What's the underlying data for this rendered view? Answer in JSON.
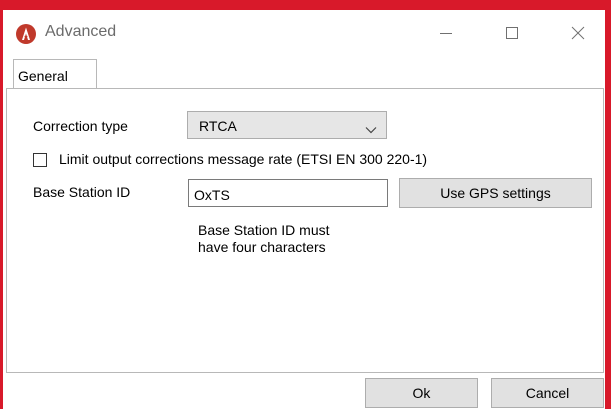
{
  "window": {
    "title": "Advanced",
    "minimize_label": "",
    "maximize_label": "",
    "close_label": ""
  },
  "tabs": [
    {
      "label": "General",
      "selected": true
    }
  ],
  "form": {
    "correction_type_label": "Correction type",
    "correction_type_value": "RTCA",
    "limit_rate_label": "Limit output corrections message rate (ETSI EN 300 220-1)",
    "limit_rate_checked": false,
    "base_station_label": "Base Station ID",
    "base_station_value": "OxTS",
    "use_gps_button": "Use GPS settings",
    "hint_line1": "Base Station ID must",
    "hint_line2": "have four characters"
  },
  "footer": {
    "ok_label": "Ok",
    "cancel_label": "Cancel"
  },
  "colors": {
    "accent_frame": "#d8192a",
    "app_icon": "#c0392b"
  },
  "icons": {
    "app": "app-logo-icon",
    "minimize": "minimize-icon",
    "maximize": "maximize-icon",
    "close": "close-icon",
    "dropdown": "chevron-down-icon"
  }
}
